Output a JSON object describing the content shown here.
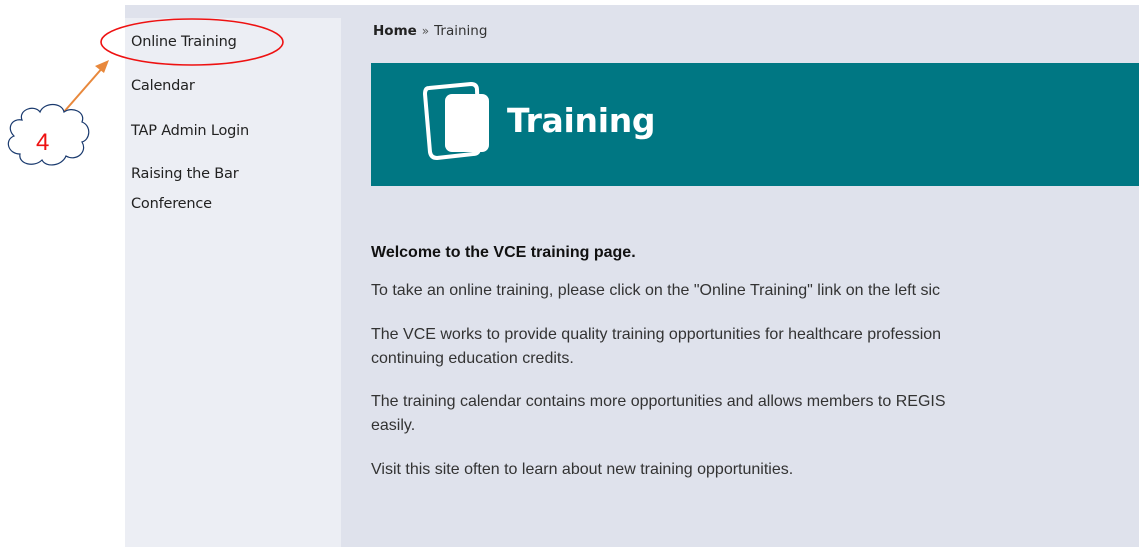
{
  "sidebar": {
    "items": [
      {
        "label": "Online Training"
      },
      {
        "label": "Calendar"
      },
      {
        "label": "TAP Admin Login"
      },
      {
        "label": "Raising the Bar"
      },
      {
        "label": "Conference"
      }
    ]
  },
  "breadcrumb": {
    "home": "Home",
    "separator": "»",
    "current": "Training"
  },
  "banner": {
    "title": "Training",
    "background": "#007783"
  },
  "main": {
    "welcome": "Welcome to the VCE training page.",
    "paragraphs": [
      "To take an online training, please click on the \"Online Training\" link on the left sic",
      "The VCE works to provide quality training opportunities for healthcare profession",
      "continuing education credits.",
      "The training calendar contains more opportunities and allows members to REGIS",
      "easily.",
      "Visit this site often to learn about new training opportunities."
    ]
  },
  "annotation": {
    "step": "4",
    "color": "#ee1111",
    "arrow_color": "#e8883c"
  }
}
